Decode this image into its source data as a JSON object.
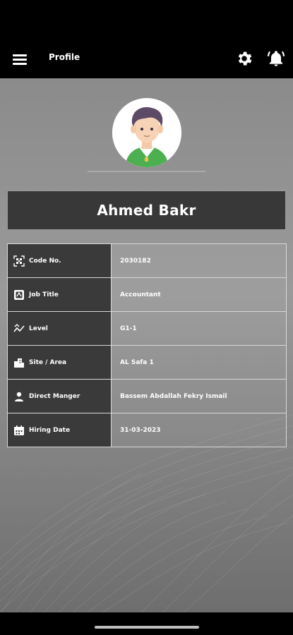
{
  "app_bar": {
    "title": "Profile",
    "menu_icon": "hamburger-menu-icon",
    "settings_icon": "gear-icon",
    "notifications_icon": "bell-alert-icon"
  },
  "profile": {
    "name": "Ahmed Bakr",
    "avatar": "user-avatar-illustration"
  },
  "details": [
    {
      "icon": "qr-code-icon",
      "label": "Code No.",
      "value": "2030182"
    },
    {
      "icon": "badge-id-icon",
      "label": "Job Title",
      "value": "Accountant"
    },
    {
      "icon": "trend-chart-icon",
      "label": "Level",
      "value": "G1-1"
    },
    {
      "icon": "buildings-icon",
      "label": "Site / Area",
      "value": "AL Safa 1"
    },
    {
      "icon": "person-icon",
      "label": "Direct Manger",
      "value": "Bassem Abdallah Fekry Ismail"
    },
    {
      "icon": "calendar-icon",
      "label": "Hiring Date",
      "value": "31-03-2023"
    }
  ],
  "colors": {
    "app_bar": "#000000",
    "banner": "#383838",
    "label_cell": "#3a3a3a",
    "avatar_shirt": "#4caf50",
    "avatar_hair": "#5d4a66"
  }
}
